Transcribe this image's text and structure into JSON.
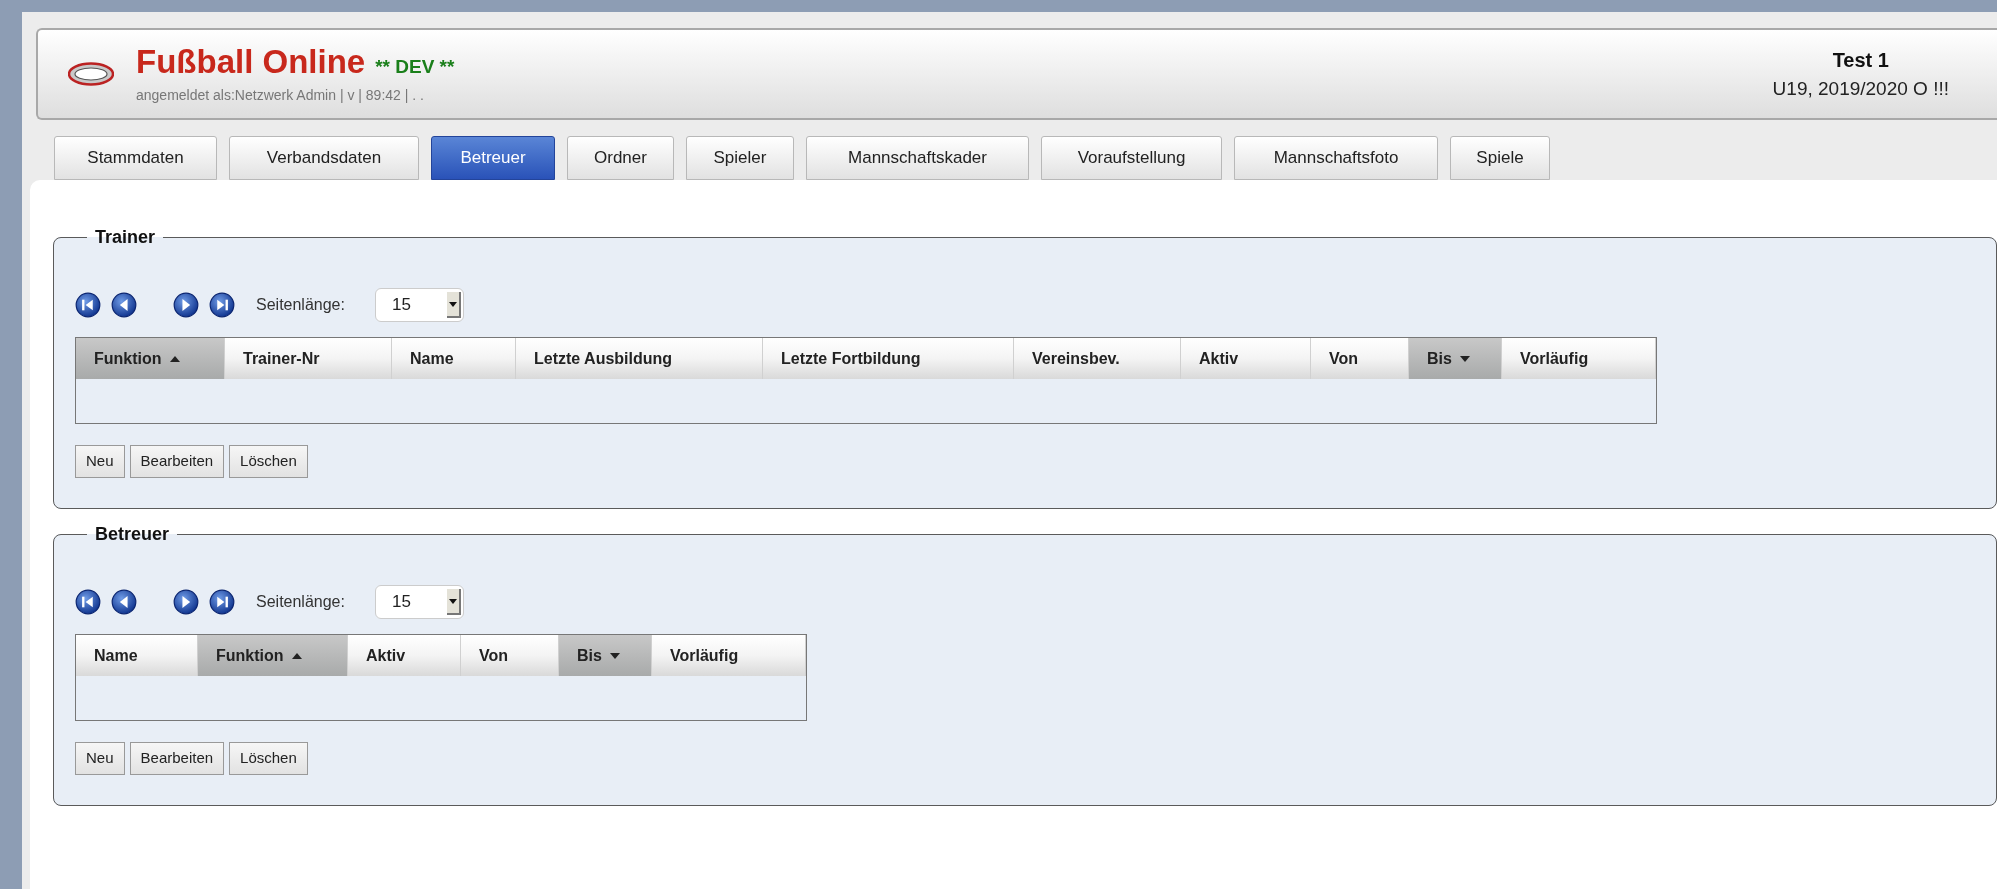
{
  "header": {
    "title": "Fußball Online",
    "badge": "** DEV **",
    "login": "angemeldet als:Netzwerk Admin | v | 89:42 | . .",
    "team": "Test 1",
    "season": "U19, 2019/2020 O !!!"
  },
  "tabs": [
    {
      "label": "Stammdaten",
      "selected": false
    },
    {
      "label": "Verbandsdaten",
      "selected": false
    },
    {
      "label": "Betreuer",
      "selected": true
    },
    {
      "label": "Ordner",
      "selected": false
    },
    {
      "label": "Spieler",
      "selected": false
    },
    {
      "label": "Mannschaftskader",
      "selected": false
    },
    {
      "label": "Voraufstellung",
      "selected": false
    },
    {
      "label": "Mannschaftsfoto",
      "selected": false
    },
    {
      "label": "Spiele",
      "selected": false
    }
  ],
  "sections": [
    {
      "legend": "Trainer",
      "page_size_label": "Seitenlänge:",
      "page_size": "15",
      "columns": [
        {
          "label": "Funktion",
          "sort_ascending": true,
          "sort_descending": false
        },
        {
          "label": "Trainer-Nr",
          "sort_ascending": false,
          "sort_descending": false
        },
        {
          "label": "Name",
          "sort_ascending": false,
          "sort_descending": false
        },
        {
          "label": "Letzte Ausbildung",
          "sort_ascending": false,
          "sort_descending": false
        },
        {
          "label": "Letzte Fortbildung",
          "sort_ascending": false,
          "sort_descending": false
        },
        {
          "label": "Vereinsbev.",
          "sort_ascending": false,
          "sort_descending": false
        },
        {
          "label": "Aktiv",
          "sort_ascending": false,
          "sort_descending": false
        },
        {
          "label": "Von",
          "sort_ascending": false,
          "sort_descending": false
        },
        {
          "label": "Bis",
          "sort_ascending": false,
          "sort_descending": true
        },
        {
          "label": "Vorläufig",
          "sort_ascending": false,
          "sort_descending": false
        }
      ],
      "buttons": [
        "Neu",
        "Bearbeiten",
        "Löschen"
      ]
    },
    {
      "legend": "Betreuer",
      "page_size_label": "Seitenlänge:",
      "page_size": "15",
      "columns": [
        {
          "label": "Name",
          "sort_ascending": false,
          "sort_descending": false
        },
        {
          "label": "Funktion",
          "sort_ascending": true,
          "sort_descending": false
        },
        {
          "label": "Aktiv",
          "sort_ascending": false,
          "sort_descending": false
        },
        {
          "label": "Von",
          "sort_ascending": false,
          "sort_descending": false
        },
        {
          "label": "Bis",
          "sort_ascending": false,
          "sort_descending": true
        },
        {
          "label": "Vorläufig",
          "sort_ascending": false,
          "sort_descending": false
        }
      ],
      "buttons": [
        "Neu",
        "Bearbeiten",
        "Löschen"
      ]
    }
  ]
}
